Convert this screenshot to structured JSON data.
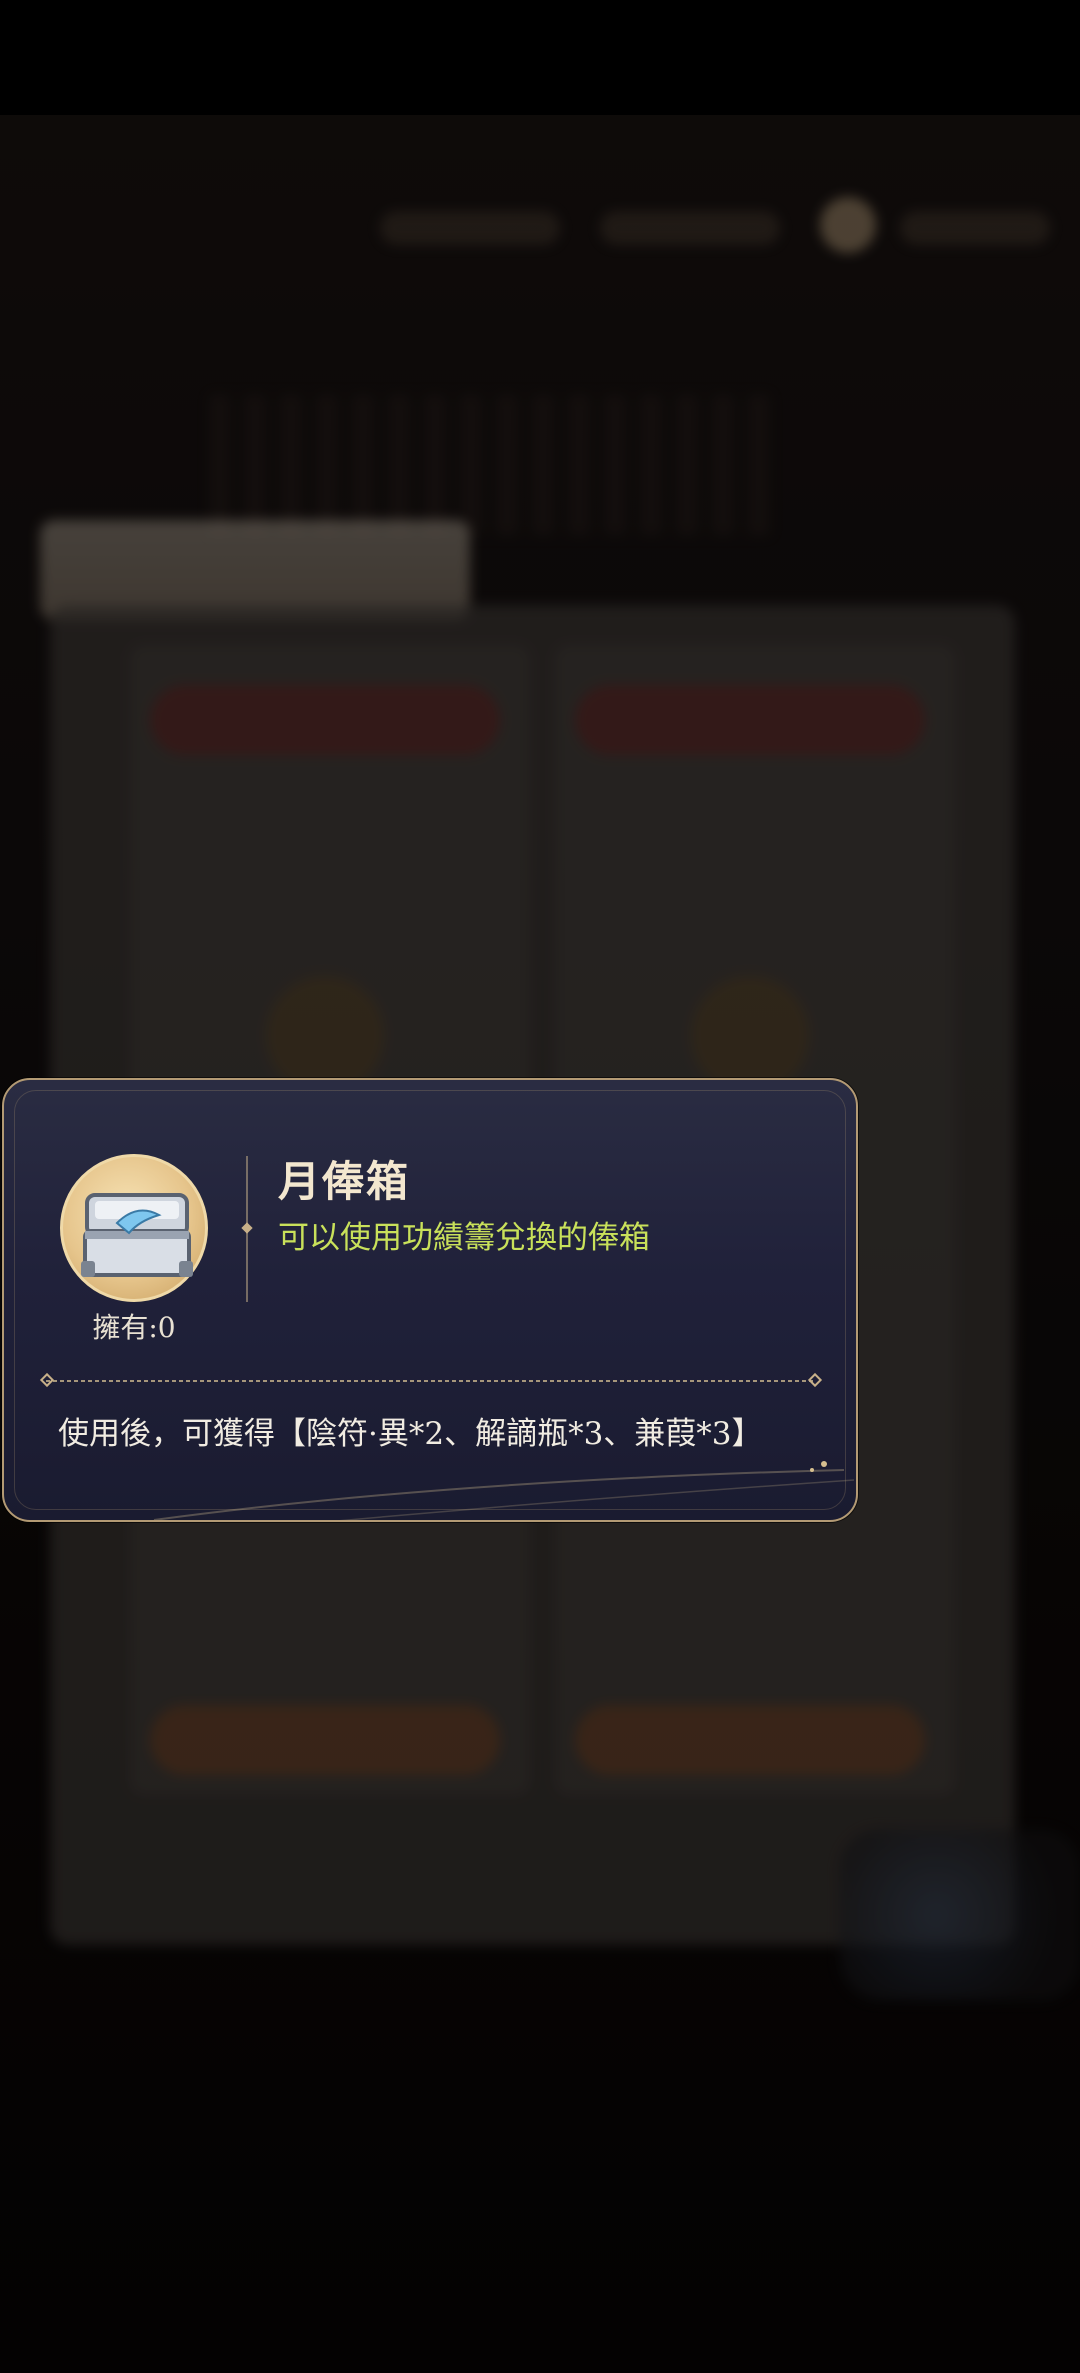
{
  "tooltip": {
    "item_name": "月俸箱",
    "item_description": "可以使用功績籌兌換的俸箱",
    "owned_label": "擁有:0",
    "usage_text": "使用後，可獲得【陰符·異*2、解謫瓶*3、兼葭*3】",
    "icon": "silver-chest-icon"
  },
  "colors": {
    "card_bg": "#20213a",
    "card_border": "#b39a74",
    "title": "#f3e7cf",
    "description": "#c9e15a",
    "body_text": "#f1ece2"
  }
}
